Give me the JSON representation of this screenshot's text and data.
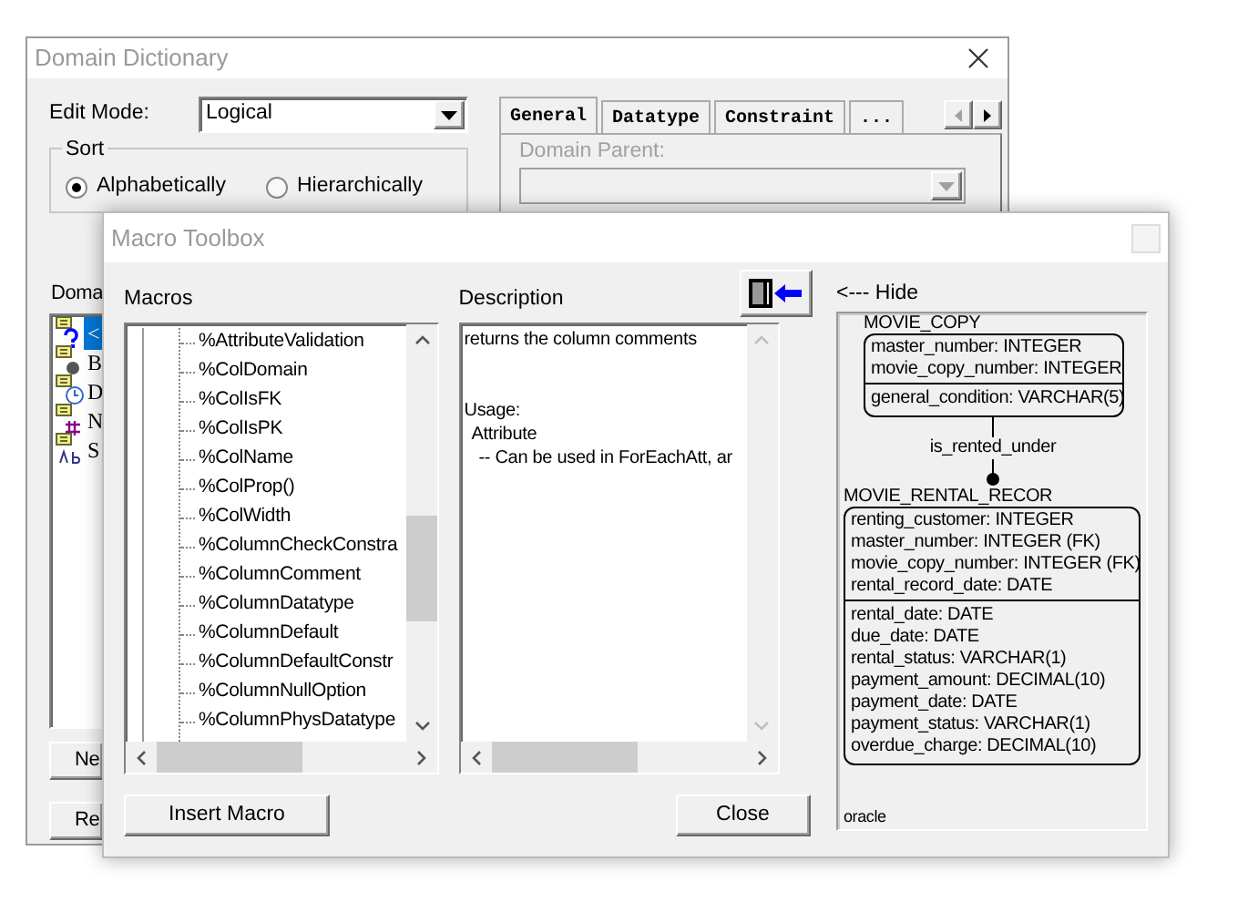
{
  "domain_dictionary": {
    "title": "Domain Dictionary",
    "edit_mode": {
      "label": "Edit Mode:",
      "value": "Logical"
    },
    "sort": {
      "label": "Sort",
      "options": [
        {
          "label": "Alphabetically",
          "selected": true
        },
        {
          "label": "Hierarchically",
          "selected": false
        }
      ]
    },
    "tabs": [
      {
        "label": "General",
        "selected": true
      },
      {
        "label": "Datatype",
        "selected": false
      },
      {
        "label": "Constraint",
        "selected": false
      },
      {
        "label": "...",
        "selected": false
      }
    ],
    "domain_parent": {
      "label": "Domain Parent:",
      "disabled": true
    },
    "domains_label": "Doma",
    "domains": [
      {
        "kind": "question",
        "text": "<",
        "selected": true
      },
      {
        "kind": "dot",
        "text": "B",
        "selected": false
      },
      {
        "kind": "clock",
        "text": "D",
        "selected": false
      },
      {
        "kind": "hash",
        "text": "N",
        "selected": false
      },
      {
        "kind": "abc",
        "text": "S",
        "selected": false
      }
    ],
    "buttons": [
      "Ne",
      "Re"
    ]
  },
  "macro_toolbox": {
    "title": "Macro Toolbox",
    "macros_label": "Macros",
    "macros": [
      "%AttributeValidation",
      "%ColDomain",
      "%ColIsFK",
      "%ColIsPK",
      "%ColName",
      "%ColProp()",
      "%ColWidth",
      "%ColumnCheckConstra",
      "%ColumnComment",
      "%ColumnDatatype",
      "%ColumnDefault",
      "%ColumnDefaultConstr",
      "%ColumnNullOption",
      "%ColumnPhysDatatype"
    ],
    "insert_button": "Insert Macro",
    "description_label": "Description",
    "description": {
      "summary": "returns the column comments",
      "usage": {
        "text": "Usage:",
        "children": [
          {
            "text": "Attribute",
            "children": [
              {
                "text": "-- Can be used in ForEachAtt, ar"
              }
            ]
          }
        ]
      }
    },
    "close_button": "Close",
    "hide_link": "<--- Hide",
    "diagram": {
      "entities": [
        {
          "name": "MOVIE_COPY",
          "keys": [
            "master_number: INTEGER",
            "movie_copy_number: INTEGER"
          ],
          "attributes": [
            "general_condition: VARCHAR(5)"
          ]
        },
        {
          "name": "MOVIE_RENTAL_RECOR",
          "keys": [
            "renting_customer: INTEGER",
            "master_number: INTEGER (FK)",
            "movie_copy_number: INTEGER (FK)",
            "rental_record_date: DATE"
          ],
          "attributes": [
            "rental_date: DATE",
            "due_date: DATE",
            "rental_status: VARCHAR(1)",
            "payment_amount: DECIMAL(10)",
            "payment_date: DATE",
            "payment_status: VARCHAR(1)",
            "overdue_charge: DECIMAL(10)"
          ]
        }
      ],
      "relationship": "is_rented_under",
      "footer": "oracle"
    }
  }
}
